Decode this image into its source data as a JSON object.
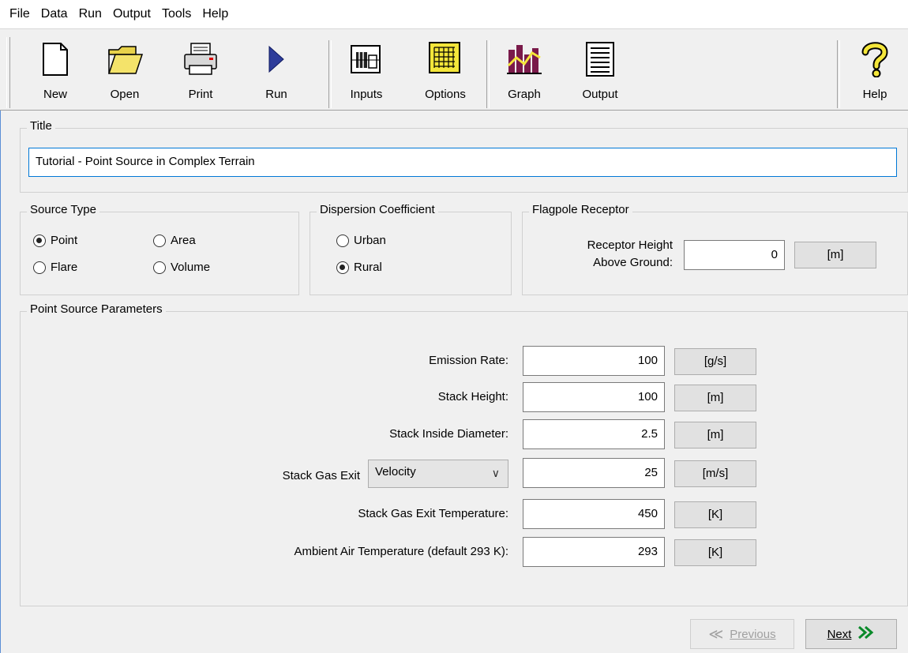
{
  "menu": [
    "File",
    "Data",
    "Run",
    "Output",
    "Tools",
    "Help"
  ],
  "toolbar": {
    "new": "New",
    "open": "Open",
    "print": "Print",
    "run": "Run",
    "inputs": "Inputs",
    "options": "Options",
    "graph": "Graph",
    "output": "Output",
    "help": "Help"
  },
  "title_group": {
    "label": "Title",
    "value": "Tutorial - Point Source in Complex Terrain"
  },
  "source_type": {
    "label": "Source Type",
    "options": [
      "Point",
      "Area",
      "Flare",
      "Volume"
    ],
    "selected": "Point"
  },
  "dispersion": {
    "label": "Dispersion Coefficient",
    "options": [
      "Urban",
      "Rural"
    ],
    "selected": "Rural"
  },
  "flagpole": {
    "label": "Flagpole Receptor",
    "field_label_1": "Receptor Height",
    "field_label_2": "Above Ground:",
    "value": "0",
    "unit": "[m]"
  },
  "params": {
    "label": "Point Source Parameters",
    "rows": [
      {
        "label": "Emission Rate:",
        "value": "100",
        "unit": "[g/s]"
      },
      {
        "label": "Stack Height:",
        "value": "100",
        "unit": "[m]"
      },
      {
        "label": "Stack Inside Diameter:",
        "value": "2.5",
        "unit": "[m]"
      },
      {
        "label": "Stack Gas Exit",
        "value": "25",
        "unit": "[m/s]",
        "select": "Velocity"
      },
      {
        "label": "Stack Gas Exit Temperature:",
        "value": "450",
        "unit": "[K]"
      },
      {
        "label": "Ambient Air Temperature (default 293 K):",
        "value": "293",
        "unit": "[K]"
      }
    ]
  },
  "nav": {
    "previous": "Previous",
    "next": "Next"
  }
}
